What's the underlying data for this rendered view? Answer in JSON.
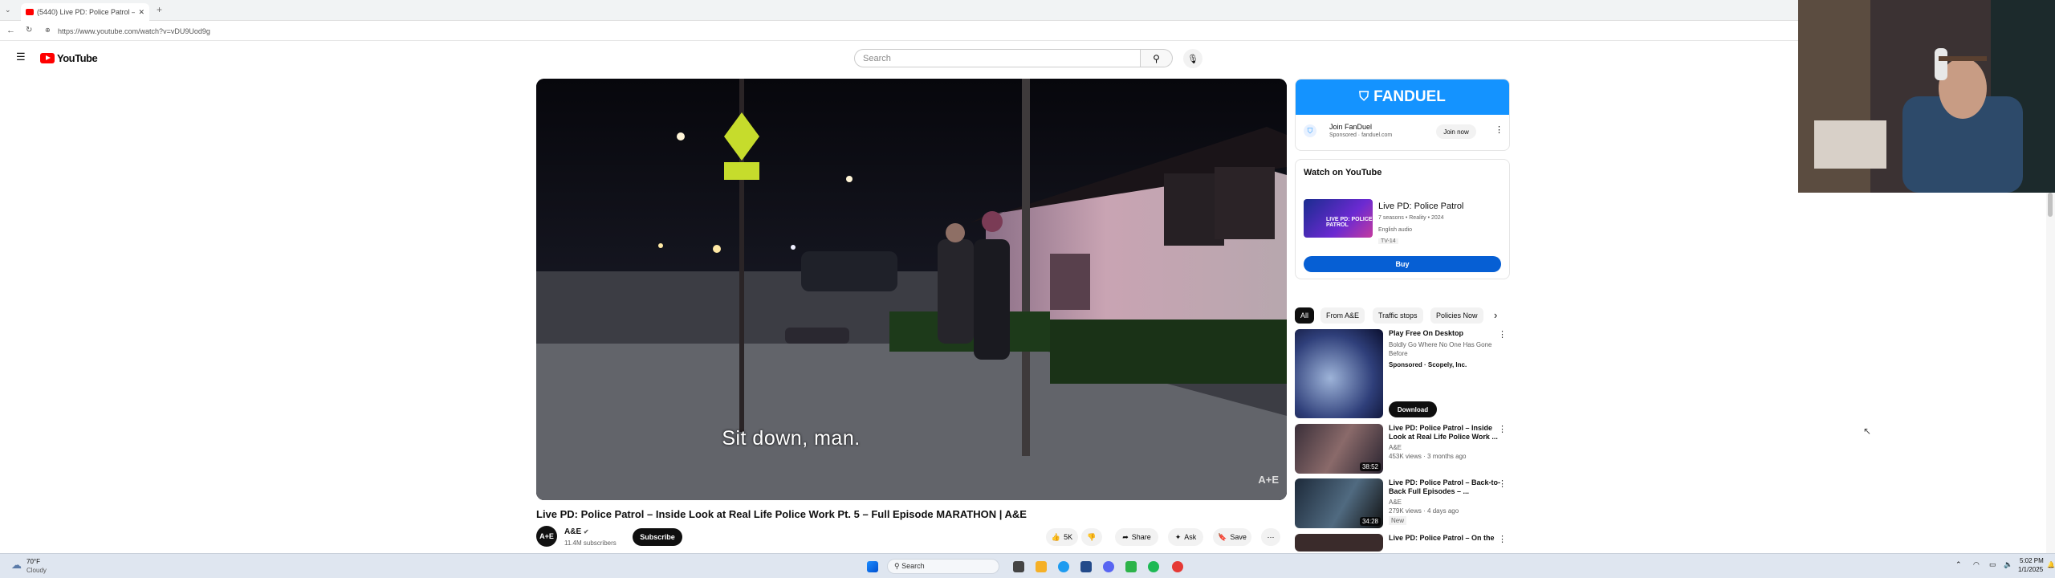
{
  "browser": {
    "tab_title": "(5440) Live PD: Police Patrol –",
    "url": "https://www.youtube.com/watch?v=vDU9Uod9g"
  },
  "header": {
    "logo": "YouTube",
    "search_placeholder": "Search"
  },
  "video": {
    "caption": "Sit down, man.",
    "watermark": "A+E",
    "title": "Live PD: Police Patrol – Inside Look at Real Life Police Work Pt. 5 – Full Episode MARATHON | A&E",
    "channel": "A&E",
    "subscribers": "11.4M subscribers",
    "subscribe_label": "Subscribe",
    "likes": "5K",
    "share_label": "Share",
    "ask_label": "Ask",
    "save_label": "Save"
  },
  "ad": {
    "brand": "FANDUEL",
    "title": "Join FanDuel",
    "sponsor": "Sponsored · fanduel.com",
    "join_label": "Join now"
  },
  "watch": {
    "heading": "Watch on YouTube",
    "show_title": "Live PD: Police Patrol",
    "show_meta": "7 seasons • Reality • 2024",
    "show_audio": "English audio",
    "rating": "TV-14",
    "buy_label": "Buy"
  },
  "chips": [
    "All",
    "From A&E",
    "Traffic stops",
    "Policies Now"
  ],
  "recommendations": [
    {
      "title": "Play Free On Desktop",
      "line1": "Boldly Go Where No One Has Gone Before",
      "line2": "Sponsored · Scopely, Inc.",
      "action": "Download",
      "duration": ""
    },
    {
      "title": "Live PD: Police Patrol – Inside Look at Real Life Police Work ...",
      "line1": "A&E",
      "line2": "453K views · 3 months ago",
      "duration": "38:52"
    },
    {
      "title": "Live PD: Police Patrol – Back-to-Back Full Episodes – ...",
      "line1": "A&E",
      "line2": "279K views · 4 days ago",
      "badge": "New",
      "duration": "34:28"
    },
    {
      "title": "Live PD: Police Patrol – On the",
      "line1": "",
      "line2": "",
      "duration": ""
    }
  ],
  "taskbar": {
    "weather_temp": "70°F",
    "weather_desc": "Cloudy",
    "search_label": "Search",
    "time": "5:02 PM",
    "date": "1/1/2025"
  },
  "colors": {
    "youtube_red": "#ff0000",
    "fanduel_blue": "#1493ff",
    "buy_blue": "#065fd4"
  }
}
